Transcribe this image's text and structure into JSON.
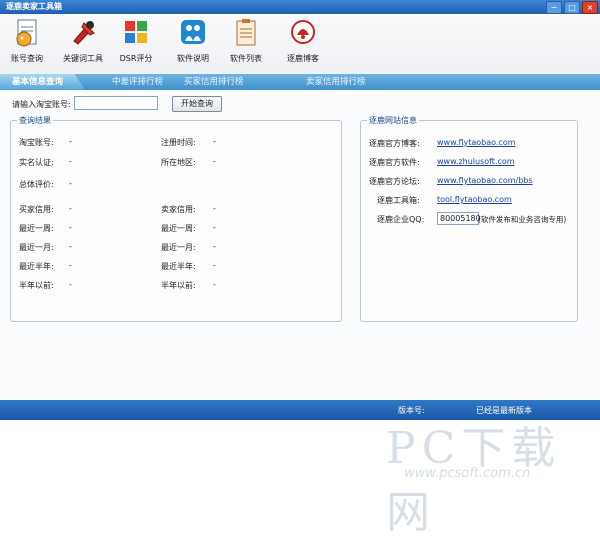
{
  "window": {
    "title": "逐鹿卖家工具箱",
    "minimize": "−",
    "maximize": "□",
    "close": "×"
  },
  "toolbar": [
    {
      "label": "账号查询",
      "icon": "account-query-icon"
    },
    {
      "label": "关键词工具",
      "icon": "keyword-tool-icon"
    },
    {
      "label": "DSR评分",
      "icon": "dsr-score-icon"
    },
    {
      "label": "软件说明",
      "icon": "software-help-icon"
    },
    {
      "label": "软件列表",
      "icon": "software-list-icon"
    },
    {
      "label": "逐鹿博客",
      "icon": "zhulu-blog-icon"
    }
  ],
  "tabs": [
    {
      "label": "基本信息查询",
      "active": true
    },
    {
      "label": "中差评排行榜",
      "active": false
    },
    {
      "label": "买家信用排行榜",
      "active": false
    },
    {
      "label": "卖家信用排行榜",
      "active": false
    }
  ],
  "search": {
    "label": "请输入淘宝账号:",
    "value": "",
    "button": "开始查询"
  },
  "results": {
    "legend": "查询结果",
    "left": [
      {
        "label": "淘宝账号:",
        "value": "-"
      },
      {
        "label": "实名认证:",
        "value": "-"
      },
      {
        "label": "总体评价:",
        "value": "-"
      }
    ],
    "right": [
      {
        "label": "注册时间:",
        "value": "-"
      },
      {
        "label": "所在地区:",
        "value": "-"
      }
    ],
    "credit_left": [
      {
        "label": "买家信用:",
        "value": "-"
      },
      {
        "label": "最近一周:",
        "value": "-"
      },
      {
        "label": "最近一月:",
        "value": "-"
      },
      {
        "label": "最近半年:",
        "value": "-"
      },
      {
        "label": "半年以前:",
        "value": "-"
      }
    ],
    "credit_right": [
      {
        "label": "卖家信用:",
        "value": "-"
      },
      {
        "label": "最近一周:",
        "value": "-"
      },
      {
        "label": "最近一月:",
        "value": "-"
      },
      {
        "label": "最近半年:",
        "value": "-"
      },
      {
        "label": "半年以前:",
        "value": "-"
      }
    ]
  },
  "site_info": {
    "legend": "逐鹿网站信息",
    "rows": [
      {
        "label": "逐鹿官方博客:",
        "value": "www.flytaobao.com"
      },
      {
        "label": "逐鹿官方软件:",
        "value": "www.zhulusoft.com"
      },
      {
        "label": "逐鹿官方论坛:",
        "value": "www.flytaobao.com/bbs"
      },
      {
        "label": "逐鹿工具箱:",
        "value": "tool.flytaobao.com"
      }
    ],
    "qq": {
      "label": "逐鹿企业QQ:",
      "value": "80005180",
      "note": "(软件发布和业务咨询专用)"
    }
  },
  "status": {
    "version_label": "版本号:",
    "version_value": "",
    "update_text": "已经是最新版本"
  },
  "watermark": {
    "main": "PC下载网",
    "sub": "www.pcsoft.com.cn"
  }
}
